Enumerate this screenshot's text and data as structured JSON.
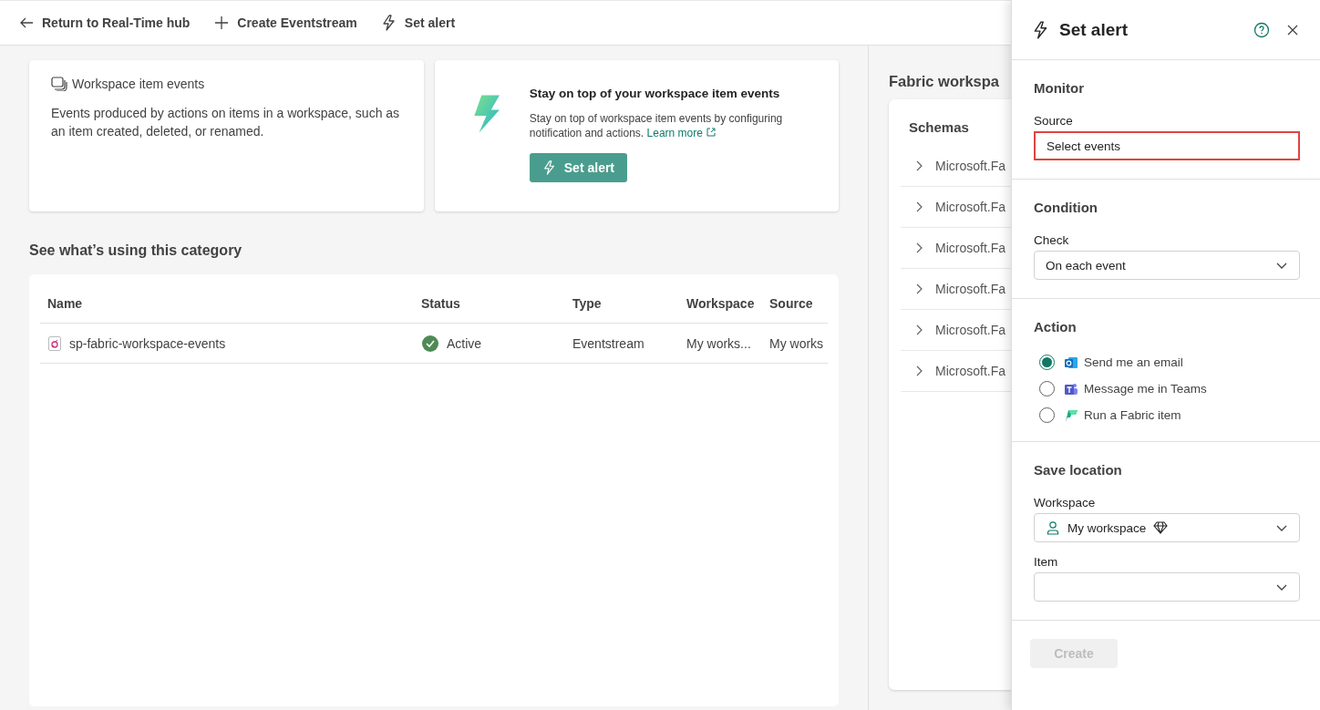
{
  "toolbar": [
    {
      "kind": "back",
      "label": "Return to Real-Time hub"
    },
    {
      "kind": "add",
      "label": "Create Eventstream"
    },
    {
      "kind": "alert",
      "label": "Set alert"
    }
  ],
  "info_card": {
    "title": "Workspace item events",
    "description": "Events produced by actions on items in a workspace, such as an item created, deleted, or renamed."
  },
  "promo_card": {
    "title": "Stay on top of your workspace item events",
    "description": "Stay on top of workspace item events by configuring notification and actions.",
    "link": "Learn more",
    "button": "Set alert"
  },
  "usage": {
    "heading": "See what’s using this category",
    "columns": [
      "Name",
      "Status",
      "Type",
      "Workspace",
      "Source"
    ],
    "rows": [
      {
        "name": "sp-fabric-workspace-events",
        "status": "Active",
        "type": "Eventstream",
        "workspace": "My works...",
        "source": "My works"
      }
    ]
  },
  "side": {
    "heading": "Fabric workspa",
    "card_title": "Schemas",
    "items": [
      {
        "label": "Microsoft.Fa",
        "expanded": false
      },
      {
        "label": "Microsoft.Fa",
        "expanded": false
      },
      {
        "label": "Microsoft.Fa",
        "expanded": false
      },
      {
        "label": "Microsoft.Fa",
        "expanded": false
      },
      {
        "label": "Microsoft.Fa",
        "expanded": false
      },
      {
        "label": "Microsoft.Fa",
        "expanded": false
      }
    ]
  },
  "panel": {
    "title": "Set alert",
    "monitor": {
      "heading": "Monitor",
      "label": "Source",
      "value": "Select events",
      "highlighted": true
    },
    "condition": {
      "heading": "Condition",
      "label": "Check",
      "value": "On each event"
    },
    "action": {
      "heading": "Action",
      "options": [
        {
          "kind": "email",
          "label": "Send me an email",
          "selected": true
        },
        {
          "kind": "teams",
          "label": "Message me in Teams",
          "selected": false
        },
        {
          "kind": "fabric",
          "label": "Run a Fabric item",
          "selected": false
        }
      ]
    },
    "save": {
      "heading": "Save location",
      "workspace_label": "Workspace",
      "workspace_value": "My workspace",
      "item_label": "Item"
    },
    "create": {
      "label": "Create",
      "disabled": true
    }
  }
}
